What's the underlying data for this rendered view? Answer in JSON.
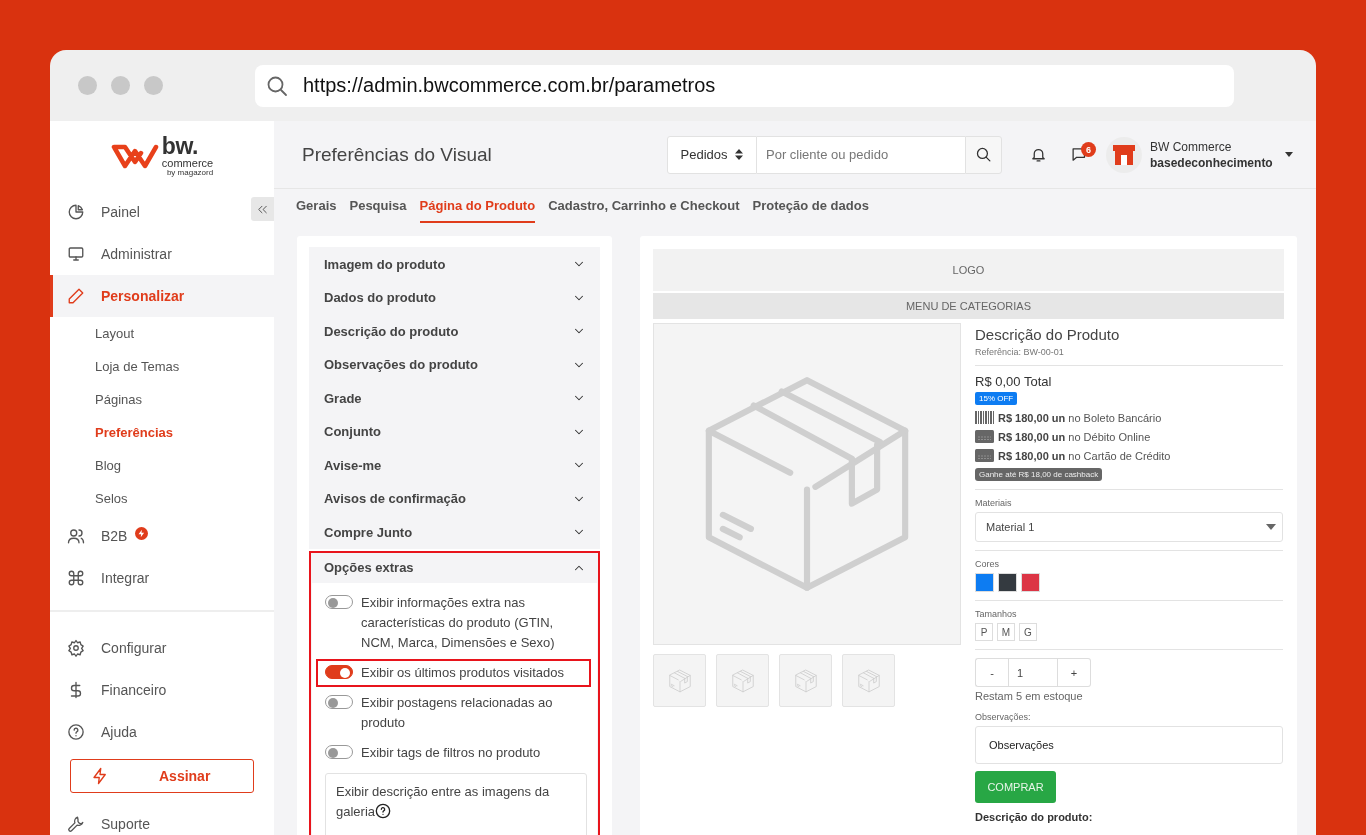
{
  "browser": {
    "url": "https://admin.bwcommerce.com.br/parametros"
  },
  "logo": {
    "name": "bw.",
    "tagline": "commerce",
    "by": "by magazord"
  },
  "sidebar": {
    "items": [
      {
        "label": "Painel",
        "selected": false,
        "badge": false
      },
      {
        "label": "Administrar",
        "selected": false,
        "badge": false
      },
      {
        "label": "Personalizar",
        "selected": true,
        "badge": false,
        "children": [
          {
            "label": "Layout",
            "selected": false
          },
          {
            "label": "Loja de Temas",
            "selected": false
          },
          {
            "label": "Páginas",
            "selected": false
          },
          {
            "label": "Preferências",
            "selected": true
          },
          {
            "label": "Blog",
            "selected": false
          },
          {
            "label": "Selos",
            "selected": false
          }
        ]
      },
      {
        "label": "B2B",
        "selected": false,
        "badge": true
      },
      {
        "label": "Integrar",
        "selected": false,
        "badge": false
      }
    ],
    "footer_items": [
      {
        "kind": "link",
        "label": "Configurar"
      },
      {
        "kind": "link",
        "label": "Financeiro"
      },
      {
        "kind": "link",
        "label": "Ajuda"
      },
      {
        "kind": "button",
        "label": "Assinar"
      },
      {
        "kind": "link",
        "label": "Suporte"
      }
    ]
  },
  "header": {
    "title": "Preferências do Visual",
    "search": {
      "scope": "Pedidos",
      "placeholder": "Por cliente ou pedido"
    },
    "messages_count": "6",
    "user": {
      "name": "BW Commerce",
      "store": "basedeconhecimento"
    }
  },
  "tabs": [
    {
      "label": "Gerais",
      "selected": false
    },
    {
      "label": "Pesquisa",
      "selected": false
    },
    {
      "label": "Página do Produto",
      "selected": true
    },
    {
      "label": "Cadastro, Carrinho e Checkout",
      "selected": false
    },
    {
      "label": "Proteção de dados",
      "selected": false
    }
  ],
  "settings": {
    "sections": [
      {
        "title": "Imagem do produto",
        "expanded": false,
        "highlighted": false
      },
      {
        "title": "Dados do produto",
        "expanded": false,
        "highlighted": false
      },
      {
        "title": "Descrição do produto",
        "expanded": false,
        "highlighted": false
      },
      {
        "title": "Observações do produto",
        "expanded": false,
        "highlighted": false
      },
      {
        "title": "Grade",
        "expanded": false,
        "highlighted": false
      },
      {
        "title": "Conjunto",
        "expanded": false,
        "highlighted": false
      },
      {
        "title": "Avise-me",
        "expanded": false,
        "highlighted": false
      },
      {
        "title": "Avisos de confirmação",
        "expanded": false,
        "highlighted": false
      },
      {
        "title": "Compre Junto",
        "expanded": false,
        "highlighted": false
      },
      {
        "title": "Opções extras",
        "expanded": true,
        "highlighted": true,
        "options": [
          {
            "kind": "toggle",
            "label": "Exibir informações extra nas características do produto (GTIN, NCM, Marca, Dimensões e Sexo)",
            "on": false,
            "highlighted": false
          },
          {
            "kind": "toggle",
            "label": "Exibir os últimos produtos visitados",
            "on": true,
            "highlighted": true
          },
          {
            "kind": "toggle",
            "label": "Exibir postagens relacionadas ao produto",
            "on": false,
            "highlighted": false
          },
          {
            "kind": "toggle",
            "label": "Exibir tags de filtros no produto",
            "on": false,
            "highlighted": false
          },
          {
            "kind": "select",
            "label": "Exibir descrição entre as imagens da galeria",
            "help": true
          }
        ]
      }
    ]
  },
  "preview": {
    "logo_label": "LOGO",
    "menu_label": "MENU DE CATEGORIAS",
    "thumbnails": [
      {
        "kind": "box"
      },
      {
        "kind": "box"
      },
      {
        "kind": "box"
      },
      {
        "kind": "box"
      }
    ],
    "product": {
      "title": "Descrição do Produto",
      "reference": "Referência: BW-00-01",
      "total": "R$ 0,00 Total",
      "discount": "15% OFF",
      "prices": [
        {
          "kind": "slip",
          "text": "**R$ 180,00 un** no Boleto Bancário"
        },
        {
          "kind": "card",
          "text": "**R$ 180,00 un** no Débito Online"
        },
        {
          "kind": "card",
          "text": "**R$ 180,00 un** no Cartão de Crédito"
        }
      ],
      "cashback": "Ganhe até R$ 18,00 de cashback",
      "materials": {
        "label": "Materiais",
        "value": "Material 1"
      },
      "colors": {
        "label": "Cores",
        "swatches": [
          {
            "color": "#0d7cf2"
          },
          {
            "color": "#343a40"
          },
          {
            "color": "#dc3545"
          }
        ]
      },
      "sizes": {
        "label": "Tamanhos",
        "options": [
          "P",
          "M",
          "G"
        ]
      },
      "quantity": {
        "minus": "-",
        "value": "1",
        "plus": "+"
      },
      "stock": "Restam 5 em estoque",
      "notes": {
        "label": "Observações:",
        "value": "Observações"
      },
      "buy_button": "COMPRAR",
      "description_heading": "Descrição do produto:"
    }
  }
}
